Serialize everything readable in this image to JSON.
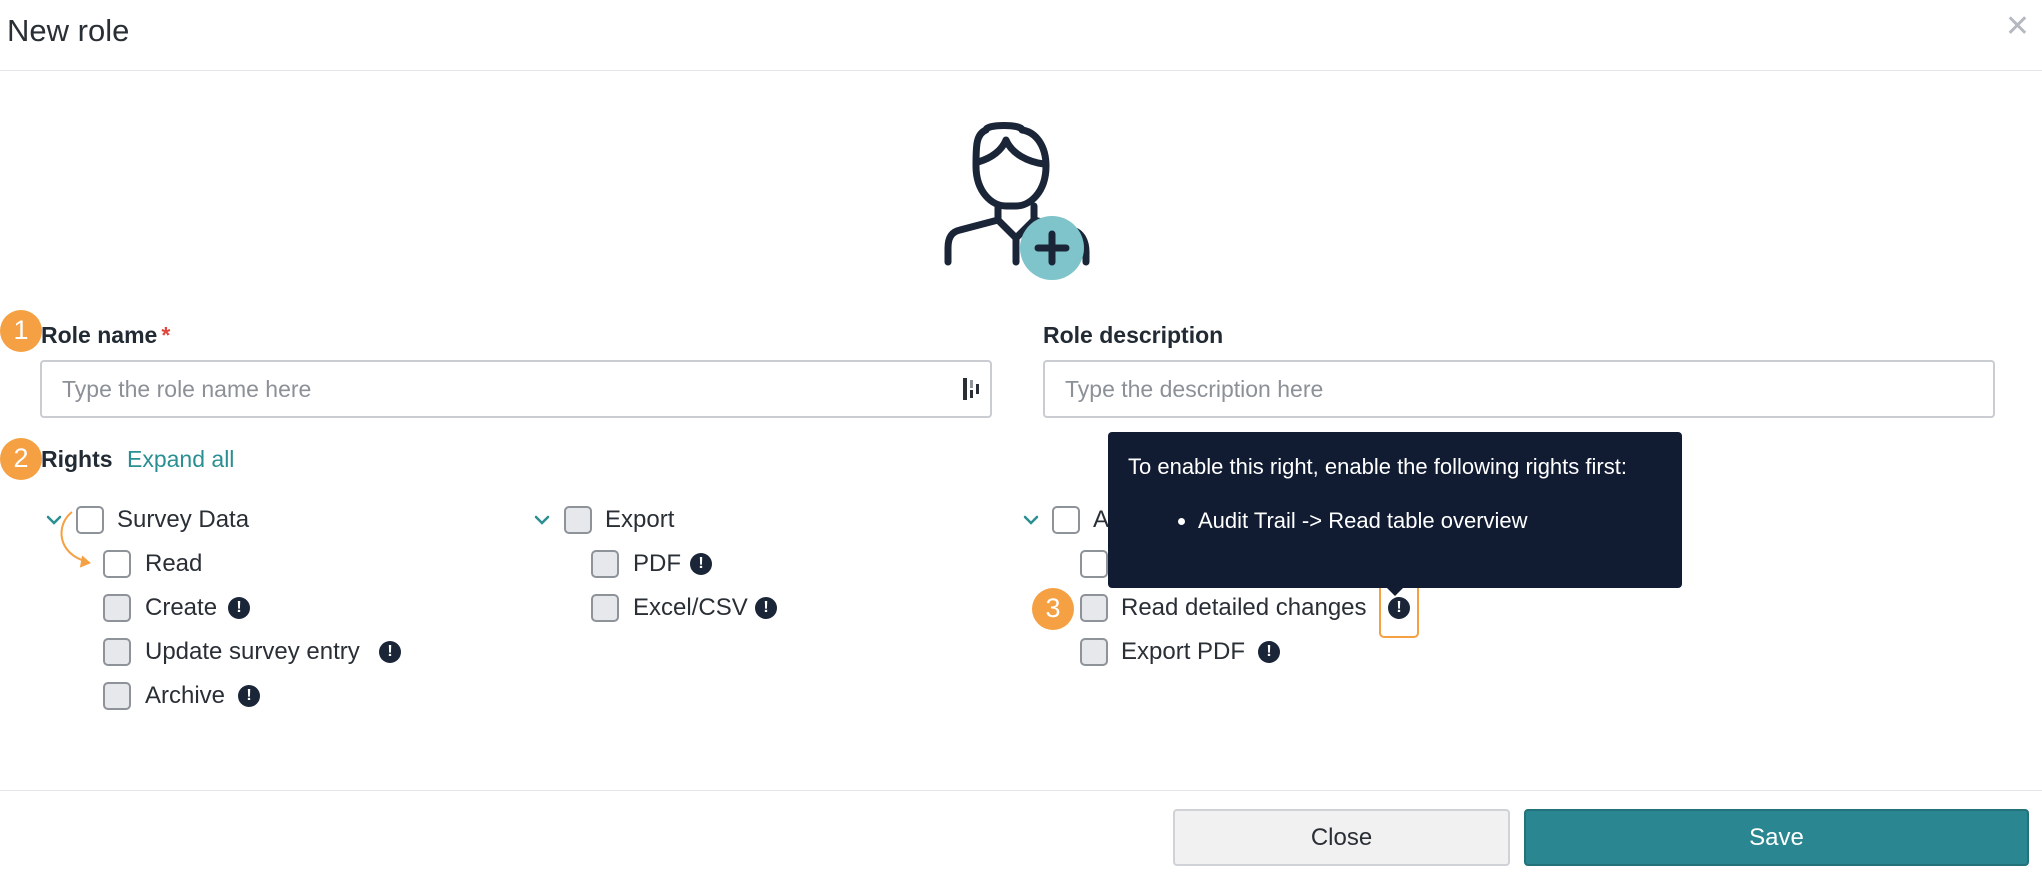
{
  "dialog": {
    "title": "New role"
  },
  "badges": {
    "one": "1",
    "two": "2",
    "three": "3"
  },
  "role_name": {
    "label": "Role name",
    "required_mark": "*",
    "placeholder": "Type the role name here",
    "value": ""
  },
  "role_description": {
    "label": "Role description",
    "placeholder": "Type the description here",
    "value": ""
  },
  "rights": {
    "label": "Rights",
    "expand_all": "Expand all",
    "survey_data": {
      "label": "Survey Data",
      "items": [
        "Read",
        "Create",
        "Update survey entry",
        "Archive"
      ]
    },
    "export": {
      "label": "Export",
      "items": [
        "PDF",
        "Excel/CSV"
      ]
    },
    "audit_trail": {
      "label": "A",
      "items": [
        "Read detailed changes",
        "Export PDF"
      ]
    }
  },
  "tooltip": {
    "title": "To enable this right, enable the following rights first:",
    "items": [
      "Audit Trail -> Read table overview"
    ]
  },
  "info_glyph": "!",
  "footer": {
    "close_label": "Close",
    "save_label": "Save"
  },
  "colors": {
    "accent": "#2a8690",
    "badge": "#f5a042",
    "tooltip_bg": "#111c33",
    "required": "#e0463d"
  },
  "icons": {
    "close": "close-icon",
    "avatar": "user-add-icon",
    "input_adorn": "password-manager-icon",
    "info": "exclamation-circle-icon",
    "chevron": "chevron-down-icon"
  }
}
